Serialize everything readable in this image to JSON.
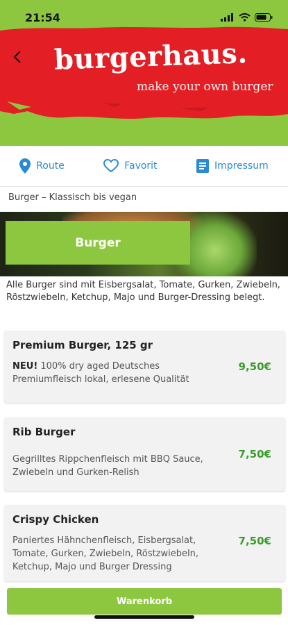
{
  "status_bar": {
    "time": "21:54"
  },
  "header": {
    "logo": "burgerhaus.",
    "tagline": "make your own burger"
  },
  "actions": [
    {
      "label": "Route",
      "icon": "location-pin-icon"
    },
    {
      "label": "Favorit",
      "icon": "heart-icon"
    },
    {
      "label": "Impressum",
      "icon": "document-icon"
    }
  ],
  "breadcrumb": "Burger – Klassisch bis vegan",
  "category": {
    "button_label": "Burger",
    "description": "Alle Burger sind mit Eisbergsalat, Tomate, Gurken, Zwiebeln, Röstzwiebeln, Ketchup, Majo und Burger-Dressing belegt."
  },
  "products": [
    {
      "title": "Premium Burger, 125 gr",
      "badge": "NEU!",
      "description": "100% dry aged Deutsches Premiumfleisch lokal, erlesene Qualität",
      "price": "9,50€"
    },
    {
      "title": "Rib Burger",
      "description": "Gegrilltes Rippchenfleisch mit BBQ Sauce, Zwiebeln und Gurken-Relish",
      "price": "7,50€"
    },
    {
      "title": "Crispy Chicken",
      "description": "Paniertes Hähnchenfleisch, Eisbergsalat, Tomate, Gurken, Zwiebeln, Röstzwiebeln, Ketchup, Majo und Burger Dressing",
      "price": "7,50€"
    }
  ],
  "cart": {
    "label": "Warenkorb"
  },
  "colors": {
    "brand_green": "#8dc63f",
    "banner_red": "#e31e24",
    "link_blue": "#2b8ad6",
    "price_green": "#3a9d2a"
  }
}
